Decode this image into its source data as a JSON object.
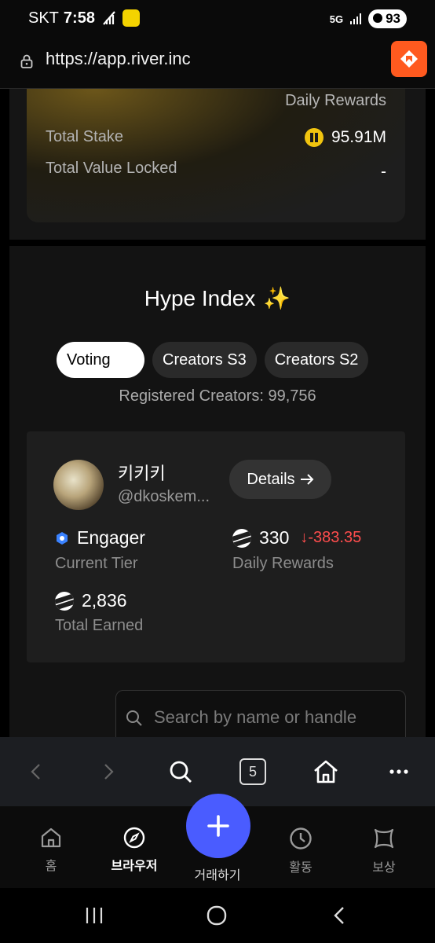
{
  "status_bar": {
    "carrier": "SKT",
    "time": "7:58",
    "network": "5G",
    "battery": "93"
  },
  "browser": {
    "url": "https://app.river.inc",
    "tab_count": "5"
  },
  "stake_card": {
    "daily_rewards_caption": "Daily Rewards",
    "total_stake_label": "Total Stake",
    "total_stake_value": "95.91M",
    "tvl_label": "Total Value Locked",
    "tvl_value": "-"
  },
  "hype": {
    "title": "Hype Index",
    "tabs": [
      {
        "label": "Voting",
        "active": true
      },
      {
        "label": "Creators S3",
        "active": false
      },
      {
        "label": "Creators S2",
        "active": false
      }
    ],
    "registered": "Registered Creators: 99,756"
  },
  "creator": {
    "name": "키키키",
    "handle": "@dkoskem...",
    "details_label": "Details",
    "tier": "Engager",
    "tier_caption": "Current Tier",
    "daily_rewards": "330",
    "daily_rewards_delta": "-383.35",
    "daily_rewards_caption": "Daily Rewards",
    "total_earned": "2,836",
    "total_earned_caption": "Total Earned"
  },
  "search": {
    "placeholder": "Search by name or handle"
  },
  "bottom_nav": {
    "home": "홈",
    "browser": "브라우저",
    "trade": "거래하기",
    "activity": "활동",
    "rewards": "보상"
  },
  "colors": {
    "accent": "#4a5cff",
    "negative": "#ff4d4d",
    "brand_orange": "#ff5a1f",
    "coin": "#f1c40f"
  }
}
